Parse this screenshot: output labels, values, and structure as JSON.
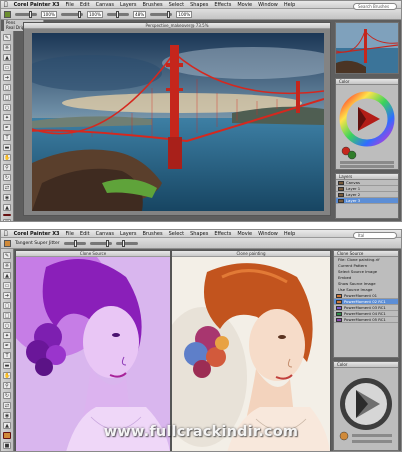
{
  "screenshot1": {
    "app_name": "Corel Painter X3",
    "menu": [
      "File",
      "Edit",
      "Canvas",
      "Layers",
      "Brushes",
      "Select",
      "Shapes",
      "Effects",
      "Movie",
      "Window",
      "Help"
    ],
    "brush_category": "Pens",
    "brush_variant": "Real Drippy Pen",
    "property_values": [
      "100%",
      "100%",
      "48%",
      "100%"
    ],
    "search_placeholder": "Search Brushes",
    "document_title": "Perspective_makeover@ 73.5%",
    "layers_panel": {
      "title": "Layers",
      "rows": [
        "Canvas",
        "Layer 1",
        "Layer 2",
        "Layer 3"
      ],
      "selected": "Layer 3"
    },
    "color_panel": {
      "title": "Color"
    }
  },
  "screenshot2": {
    "app_name": "Corel Painter X3",
    "menu": [
      "File",
      "Edit",
      "Canvas",
      "Layers",
      "Brushes",
      "Select",
      "Shapes",
      "Effects",
      "Movie",
      "Window",
      "Help"
    ],
    "brush_variant": "Tangent Super Jitter",
    "search_placeholder": "Ital",
    "left_document_title": "Clone Source",
    "right_document_title": "Clone painting",
    "clone_panel": {
      "title": "Clone Source",
      "options": [
        "File: Clone painting.rif",
        "Current Pattern",
        "Select Source Image",
        "Embed",
        "Show Source Image",
        "Use Source Image"
      ],
      "sources": [
        "PowerMoment 01",
        "PowerMoment 02 RC1",
        "PowerMoment 03 RC1",
        "PowerMoment 04 RC1",
        "PowerMoment 05 RC1"
      ],
      "selected": "PowerMoment 02 RC1"
    },
    "color_panel": {
      "title": "Color"
    }
  },
  "watermark": "www.fullcrackindir.com",
  "colors": {
    "ui_gray": "#5e5e5e",
    "bridge_red": "#d5281e",
    "selection_blue": "#5c8ed6",
    "portrait_purple": "#a53ad2",
    "portrait_hair": "#c2541e"
  }
}
